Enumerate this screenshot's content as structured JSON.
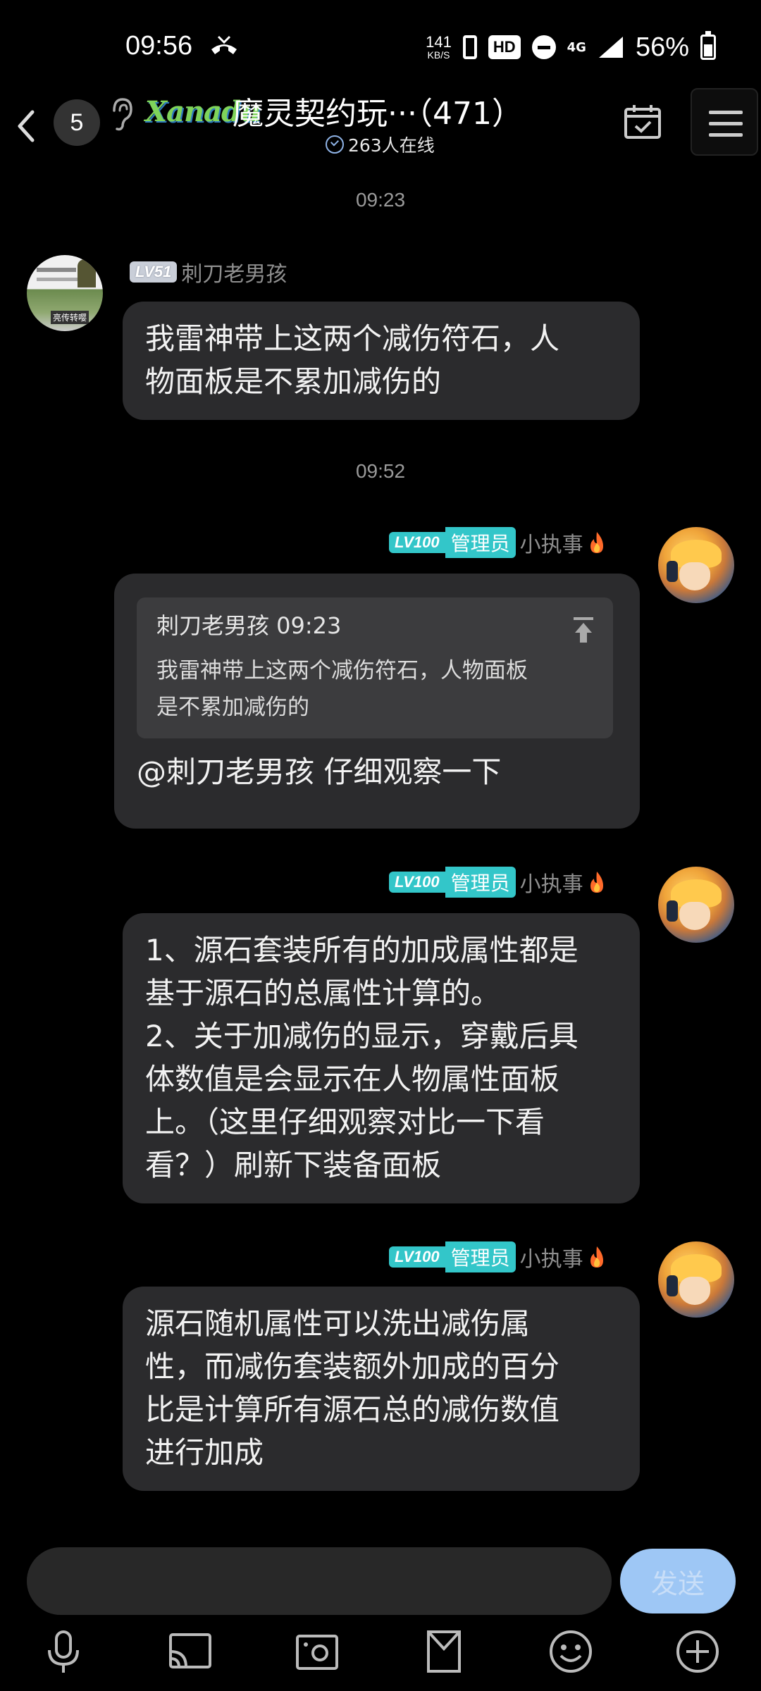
{
  "status_bar": {
    "time": "09:56",
    "net_speed_value": "141",
    "net_speed_unit": "KB/S",
    "hd_label": "HD",
    "network_type": "4G",
    "battery_percent": "56%"
  },
  "header": {
    "unread_count": "5",
    "group_logo_text": "Xanadu",
    "group_title": "魔灵契约玩···（471）",
    "online_text": "263人在线"
  },
  "messages": [
    {
      "timestamp": "09:23",
      "side": "left",
      "level": "LV51",
      "sender": "刺刀老男孩",
      "avatar_caption": "亮传转嘤",
      "text": "我雷神带上这两个减伤符石，人\n物面板是不累加减伤的"
    },
    {
      "timestamp": "09:52",
      "side": "right",
      "level": "LV100",
      "role": "管理员",
      "sender": "小执事",
      "quote_author_time": "刺刀老男孩 09:23",
      "quote_text": "我雷神带上这两个减伤符石，人物面板\n是不累加减伤的",
      "text": "@刺刀老男孩 仔细观察一下"
    },
    {
      "side": "right",
      "level": "LV100",
      "role": "管理员",
      "sender": "小执事",
      "text": "1、源石套装所有的加成属性都是\n基于源石的总属性计算的。\n2、关于加减伤的显示，穿戴后具\n体数值是会显示在人物属性面板\n上。（这里仔细观察对比一下看\n看？）刷新下装备面板"
    },
    {
      "side": "right",
      "level": "LV100",
      "role": "管理员",
      "sender": "小执事",
      "text": "源石随机属性可以洗出减伤属\n性，而减伤套装额外加成的百分\n比是计算所有源石总的减伤数值\n进行加成"
    }
  ],
  "input": {
    "send_label": "发送"
  },
  "toolbar": {
    "icons": [
      "microphone-icon",
      "cast-icon",
      "photo-icon",
      "file-icon",
      "emoji-icon",
      "plus-icon"
    ]
  },
  "colors": {
    "background": "#000000",
    "bubble": "#2b2b2d",
    "admin_badge": "#33c6c9",
    "send_button": "#9ec7f5"
  }
}
